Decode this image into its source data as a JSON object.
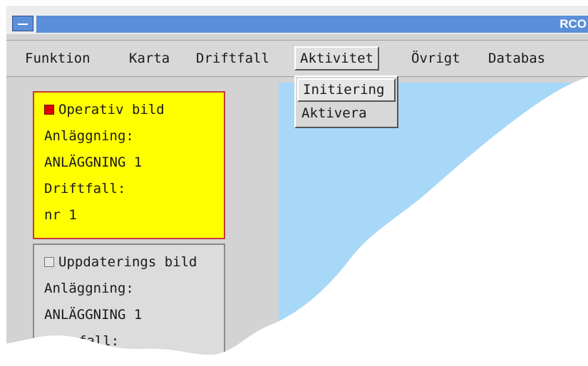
{
  "window": {
    "title": "RCO"
  },
  "menubar": {
    "items": [
      "Funktion",
      "Karta",
      "Driftfall",
      "Aktivitet",
      "Övrigt",
      "Databas"
    ],
    "active": "Aktivitet"
  },
  "dropdown": {
    "items": [
      "Initiering",
      "Aktivera"
    ],
    "highlighted": "Initiering"
  },
  "cards": [
    {
      "title": "Operativ bild",
      "checked": true,
      "plant_label": "Anläggning:",
      "plant_value": "ANLÄGGNING 1",
      "case_label": "Driftfall:",
      "case_value": "nr 1"
    },
    {
      "title": "Uppdaterings bild",
      "checked": false,
      "plant_label": "Anläggning:",
      "plant_value": "ANLÄGGNING 1",
      "case_label": "fall:"
    }
  ],
  "colors": {
    "titlebar": "#5b8fd9",
    "active_card": "#ffff00",
    "map_water": "#a8d8f8",
    "check_on": "#e00000"
  }
}
